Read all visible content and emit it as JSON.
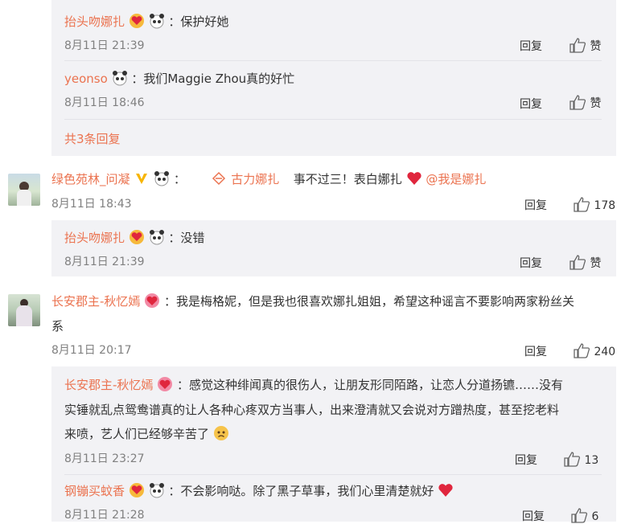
{
  "thread_top": {
    "reply1": {
      "author": "抬头吻娜扎",
      "text": "：保护好她",
      "time": "8月11日 21:39",
      "reply_label": "回复",
      "like_label": "赞"
    },
    "reply2": {
      "author": "yeonso",
      "text": "：我们Maggie Zhou真的好忙",
      "time": "8月11日 18:46",
      "reply_label": "回复",
      "like_label": "赞"
    },
    "more_replies": "共3条回复"
  },
  "comment1": {
    "author": "绿色苑林_问凝",
    "colon": "：",
    "tag": "古力娜扎",
    "text": "事不过三！表白娜扎",
    "mention": "@我是娜扎",
    "time": "8月11日 18:43",
    "reply_label": "回复",
    "likes": "178",
    "reply": {
      "author": "抬头吻娜扎",
      "text": "：没错",
      "time": "8月11日 21:39",
      "reply_label": "回复",
      "like_label": "赞"
    }
  },
  "comment2": {
    "author": "长安郡主-秋忆嫣",
    "text_line1": "：我是梅格妮，但是我也很喜欢娜扎姐姐，希望这种谣言不要影响两家粉丝关",
    "text_line2": "系",
    "time": "8月11日 20:17",
    "reply_label": "回复",
    "likes": "240",
    "reply1": {
      "author": "长安郡主-秋忆嫣",
      "line1": "：感觉这种绯闻真的很伤人，让朋友形同陌路，让恋人分道扬镳……没有",
      "line2": "实锤就乱点鸳鸯谱真的让人各种心疼双方当事人，出来澄清就又会说对方蹭热度，甚至挖老料",
      "line3": "来喷，艺人们已经够辛苦了",
      "time": "8月11日 23:27",
      "reply_label": "回复",
      "likes": "13"
    },
    "reply2": {
      "author": "钢镚买蚊香",
      "text": "：不会影响哒。除了黑子草事，我们心里清楚就好",
      "time": "8月11日 21:28",
      "reply_label": "回复",
      "likes": "6"
    }
  },
  "colors": {
    "name": "#eb7350",
    "panel": "#f2f2f5",
    "meta": "#808080",
    "heart": "#e0263d",
    "vip": "#f7b500"
  }
}
